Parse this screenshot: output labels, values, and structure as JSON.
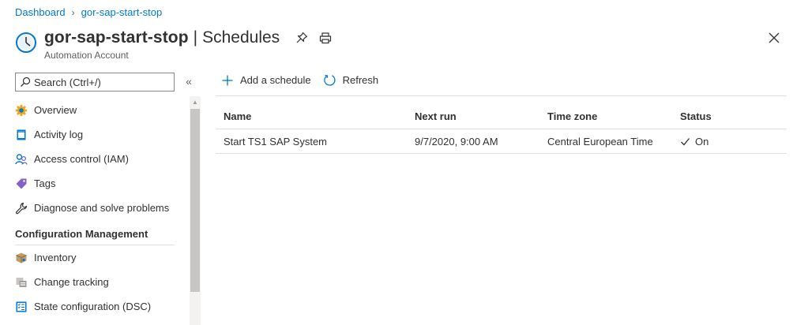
{
  "breadcrumb": {
    "items": [
      "Dashboard",
      "gor-sap-start-stop"
    ]
  },
  "header": {
    "resource": "gor-sap-start-stop",
    "separator": "|",
    "page": "Schedules",
    "subtitle": "Automation Account",
    "icon": "clock-icon"
  },
  "search": {
    "placeholder": "Search (Ctrl+/)"
  },
  "nav": {
    "items": [
      {
        "label": "Overview",
        "icon": "gear-icon"
      },
      {
        "label": "Activity log",
        "icon": "log-icon"
      },
      {
        "label": "Access control (IAM)",
        "icon": "people-icon"
      },
      {
        "label": "Tags",
        "icon": "tag-icon"
      },
      {
        "label": "Diagnose and solve problems",
        "icon": "wrench-icon"
      }
    ],
    "section": "Configuration Management",
    "section_items": [
      {
        "label": "Inventory",
        "icon": "box-icon"
      },
      {
        "label": "Change tracking",
        "icon": "change-icon"
      },
      {
        "label": "State configuration (DSC)",
        "icon": "checklist-icon"
      }
    ]
  },
  "toolbar": {
    "add_label": "Add a schedule",
    "refresh_label": "Refresh"
  },
  "table": {
    "columns": [
      "Name",
      "Next run",
      "Time zone",
      "Status"
    ],
    "rows": [
      {
        "name": "Start TS1 SAP System",
        "next_run": "9/7/2020, 9:00 AM",
        "time_zone": "Central European Time",
        "status": "On"
      }
    ]
  },
  "colors": {
    "accent": "#0078d4",
    "text": "#323130",
    "border": "#e1dfdd"
  }
}
